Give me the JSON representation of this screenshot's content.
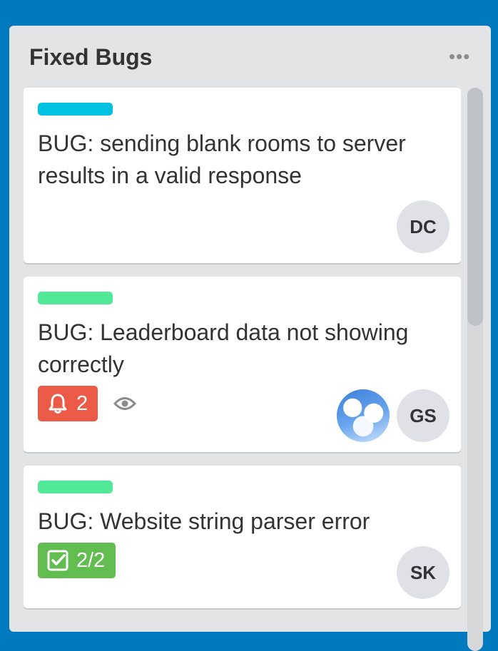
{
  "list": {
    "title": "Fixed Bugs",
    "menu_icon": "more-horizontal-icon",
    "menu_glyph": "•••"
  },
  "cards": [
    {
      "label_color": "#00c2e0",
      "title": "BUG: sending blank rooms to server results in a valid response",
      "members": [
        "DC"
      ]
    },
    {
      "label_color": "#51e898",
      "title": "BUG: Leaderboard data not showing correctly",
      "notification_badge": {
        "icon": "bell-icon",
        "count": "2",
        "color": "#eb5a46"
      },
      "watching_icon": "eye-icon",
      "members": [
        "photo-avatar",
        "GS"
      ]
    },
    {
      "label_color": "#51e898",
      "title": "BUG: Website string parser error",
      "checklist_badge": {
        "icon": "checklist-icon",
        "text": "2/2",
        "color": "#61bd4f"
      },
      "members": [
        "SK"
      ]
    }
  ]
}
